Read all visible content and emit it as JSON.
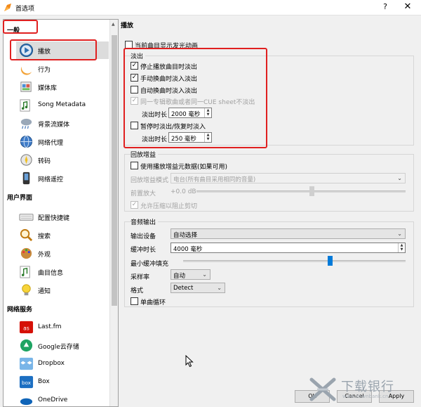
{
  "window": {
    "title": "首选项",
    "help": "?",
    "close": "✕"
  },
  "sidebar": {
    "groups": [
      {
        "label": "一般",
        "items": [
          {
            "label": "播放",
            "icon": "play-icon",
            "selected": true
          },
          {
            "label": "行为",
            "icon": "moon-icon"
          },
          {
            "label": "媒体库",
            "icon": "library-icon"
          },
          {
            "label": "Song Metadata",
            "icon": "music-note-icon"
          },
          {
            "label": "背景流媒体",
            "icon": "weather-icon"
          },
          {
            "label": "网络代理",
            "icon": "network-proxy-icon"
          },
          {
            "label": "转码",
            "icon": "transcode-icon"
          },
          {
            "label": "网络遥控",
            "icon": "remote-icon"
          }
        ]
      },
      {
        "label": "用户界面",
        "items": [
          {
            "label": "配置快捷键",
            "icon": "keyboard-icon"
          },
          {
            "label": "搜索",
            "icon": "search-icon"
          },
          {
            "label": "外观",
            "icon": "appearance-icon"
          },
          {
            "label": "曲目信息",
            "icon": "track-info-icon"
          },
          {
            "label": "通知",
            "icon": "bulb-icon"
          }
        ]
      },
      {
        "label": "网络服务",
        "items": [
          {
            "label": "Last.fm",
            "icon": "lastfm-icon"
          },
          {
            "label": "Google云存储",
            "icon": "google-drive-icon"
          },
          {
            "label": "Dropbox",
            "icon": "dropbox-icon"
          },
          {
            "label": "Box",
            "icon": "box-icon"
          },
          {
            "label": "OneDrive",
            "icon": "onedrive-icon"
          }
        ]
      }
    ]
  },
  "playback": {
    "section_title": "播放",
    "show_glow": "当前曲目显示发光动画",
    "fade": {
      "label": "淡出",
      "stop_fade": "停止播放曲目时淡出",
      "manual_crossfade": "手动换曲时淡入淡出",
      "auto_crossfade": "自动换曲时淡入淡出",
      "same_album": "同一专辑歌曲或者同一CUE sheet不淡出",
      "fade_duration_label": "淡出时长",
      "fade_duration_value": "2000 毫秒",
      "pause_fade": "暂停时淡出/恢复时淡入",
      "pause_duration_label": "淡出时长",
      "pause_duration_value": "250 毫秒"
    },
    "replaygain": {
      "label": "回放增益",
      "use_metadata": "使用播放增益元数据(如果可用)",
      "mode_label": "回放增益模式",
      "mode_value": "电台(所有曲目采用相同的音量)",
      "preamp_label": "前置放大",
      "preamp_value": "+0.0 dB",
      "preamp_level": 0.55,
      "compress": "允许压缩以阻止剪切"
    },
    "audio_output": {
      "label": "音频输出",
      "device_label": "输出设备",
      "device_value": "自动选择",
      "buffer_label": "缓冲时长",
      "buffer_value": "4000 毫秒",
      "min_fill_label": "最小缓冲填充",
      "min_fill_level": 0.66,
      "sample_rate_label": "采样率",
      "sample_rate_value": "自动",
      "format_label": "格式",
      "format_value": "Detect",
      "mono": "单曲循环"
    }
  },
  "buttons": {
    "ok": "OK",
    "cancel": "Cancel",
    "apply": "Apply"
  },
  "watermark": {
    "text": "下载银行",
    "url": "www.downbank.cn"
  },
  "colors": {
    "highlight": "#e02020",
    "accent": "#007ad9"
  }
}
